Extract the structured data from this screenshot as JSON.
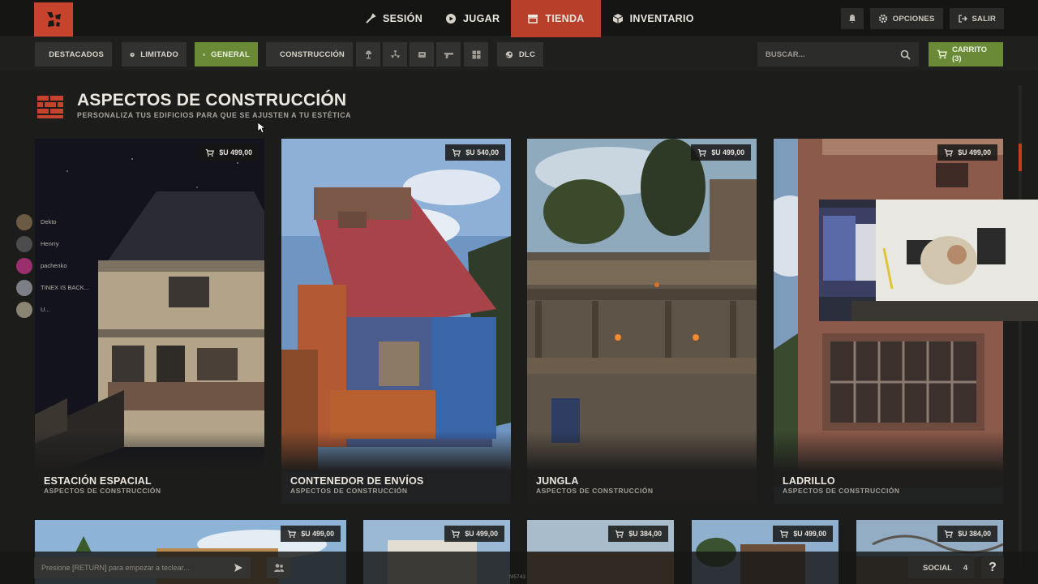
{
  "topnav": {
    "items": [
      {
        "label": "SESIÓN",
        "icon": "wrench-icon"
      },
      {
        "label": "JUGAR",
        "icon": "play-icon"
      },
      {
        "label": "TIENDA",
        "icon": "store-icon"
      },
      {
        "label": "INVENTARIO",
        "icon": "box-icon"
      }
    ],
    "options_label": "OPCIONES",
    "exit_label": "SALIR"
  },
  "filters": {
    "destacados": "DESTACADOS",
    "limitado": "LIMITADO",
    "general": "GENERAL",
    "construccion": "CONSTRUCCIÓN",
    "dlc": "DLC"
  },
  "search": {
    "placeholder": "BUSCAR..."
  },
  "cart": {
    "label": "CARRITO (3)"
  },
  "section": {
    "title": "ASPECTOS DE CONSTRUCCIÓN",
    "subtitle": "PERSONALIZA TUS EDIFICIOS PARA QUE SE AJUSTEN A TU ESTÉTICA"
  },
  "products": [
    {
      "name": "ESTACIÓN ESPACIAL",
      "category": "ASPECTOS DE CONSTRUCCIÓN",
      "price": "$U 499,00"
    },
    {
      "name": "CONTENEDOR DE ENVÍOS",
      "category": "ASPECTOS DE CONSTRUCCIÓN",
      "price": "$U 540,00"
    },
    {
      "name": "JUNGLA",
      "category": "ASPECTOS DE CONSTRUCCIÓN",
      "price": "$U 499,00"
    },
    {
      "name": "LADRILLO",
      "category": "ASPECTOS DE CONSTRUCCIÓN",
      "price": "$U 499,00"
    }
  ],
  "products_row2": [
    {
      "price": "$U 499,00"
    },
    {
      "price": "$U 499,00"
    },
    {
      "price": "$U 384,00"
    },
    {
      "price": "$U 499,00"
    },
    {
      "price": "$U 384,00"
    }
  ],
  "social_overlay": [
    {
      "name": "Dekto"
    },
    {
      "name": "Henrry"
    },
    {
      "name": "pachenko"
    },
    {
      "name": "TINEX IS BACK..."
    },
    {
      "name": "U..."
    }
  ],
  "chat": {
    "placeholder": "Presione [RETURN] para empezar a teclear..."
  },
  "build_id": "f45743",
  "social": {
    "label": "SOCIAL",
    "count": "4"
  },
  "help": {
    "label": "?"
  },
  "colors": {
    "accent": "#b8402b",
    "green": "#6a8a37",
    "background": "#1c1c1b"
  }
}
